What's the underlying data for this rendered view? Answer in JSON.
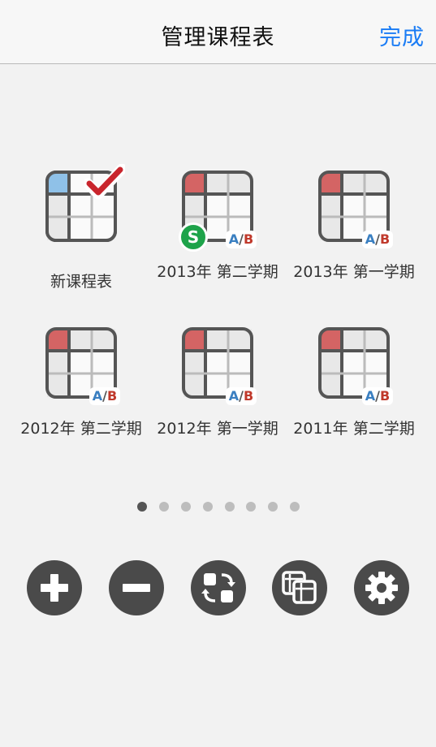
{
  "navbar": {
    "title": "管理课程表",
    "done_label": "完成"
  },
  "schedules": [
    {
      "label": "新课程表",
      "kind": "new",
      "accent": "#8fc1e8"
    },
    {
      "label": "2013年 第二学期",
      "kind": "ab",
      "synced": true,
      "sync_badge": "S",
      "accent": "#d46464",
      "badge": "A/B"
    },
    {
      "label": "2013年 第一学期",
      "kind": "ab",
      "accent": "#d46464",
      "badge": "A/B"
    },
    {
      "label": "2012年 第二学期",
      "kind": "ab",
      "accent": "#d46464",
      "badge": "A/B"
    },
    {
      "label": "2012年 第一学期",
      "kind": "ab",
      "accent": "#d46464",
      "badge": "A/B"
    },
    {
      "label": "2011年 第二学期",
      "kind": "ab",
      "accent": "#d46464",
      "badge": "A/B"
    }
  ],
  "pager": {
    "count": 8,
    "active_index": 0
  },
  "toolbar": {
    "buttons": [
      {
        "name": "add-button",
        "icon": "plus-icon"
      },
      {
        "name": "remove-button",
        "icon": "minus-icon"
      },
      {
        "name": "swap-button",
        "icon": "swap-icon"
      },
      {
        "name": "copy-button",
        "icon": "copy-icon"
      },
      {
        "name": "settings-button",
        "icon": "gear-icon"
      }
    ]
  },
  "colors": {
    "link": "#1a7cf5",
    "button_bg": "#4a4a4a",
    "sync_badge": "#1ea34a",
    "ab_a": "#3a7fc1",
    "ab_b": "#c0392b"
  }
}
